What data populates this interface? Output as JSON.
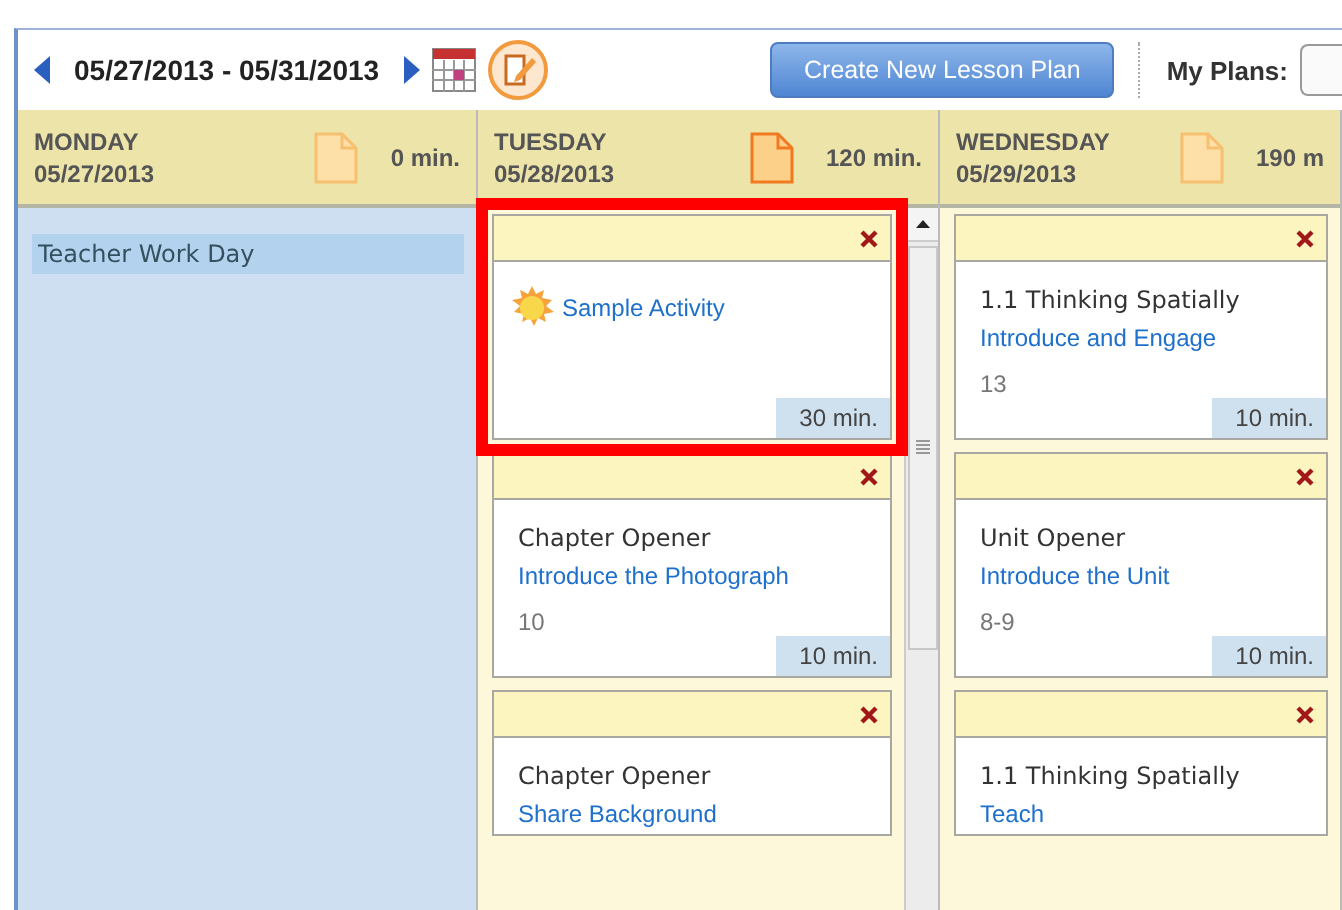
{
  "toolbar": {
    "date_range": "05/27/2013 - 05/31/2013",
    "create_button": "Create New Lesson Plan",
    "my_plans_label": "My Plans:"
  },
  "days": [
    {
      "name": "MONDAY",
      "date": "05/27/2013",
      "minutes": "0 min.",
      "has_plans": false,
      "scrollable": false,
      "items": [
        {
          "kind": "event",
          "title": "Teacher Work Day"
        }
      ]
    },
    {
      "name": "TUESDAY",
      "date": "05/28/2013",
      "minutes": "120 min.",
      "has_plans": true,
      "scrollable": true,
      "items": [
        {
          "kind": "activity",
          "link": "Sample Activity",
          "duration": "30 min.",
          "highlighted": true
        },
        {
          "kind": "lesson",
          "title": "Chapter Opener",
          "link": "Introduce the Photograph",
          "pages": "10",
          "duration": "10 min.",
          "highlighted": false
        },
        {
          "kind": "lesson",
          "title": "Chapter Opener",
          "link": "Share Background",
          "highlighted": false
        }
      ]
    },
    {
      "name": "WEDNESDAY",
      "date": "05/29/2013",
      "minutes": "190 m",
      "has_plans": false,
      "scrollable": false,
      "items": [
        {
          "kind": "lesson",
          "title": "1.1  Thinking Spatially",
          "link": "Introduce and Engage",
          "pages": "13",
          "duration": "10 min.",
          "highlighted": false
        },
        {
          "kind": "lesson",
          "title": "Unit Opener",
          "link": "Introduce the Unit",
          "pages": "8-9",
          "duration": "10 min.",
          "highlighted": false
        },
        {
          "kind": "lesson",
          "title": "1.1  Thinking Spatially",
          "link": "Teach",
          "highlighted": false
        }
      ]
    }
  ]
}
